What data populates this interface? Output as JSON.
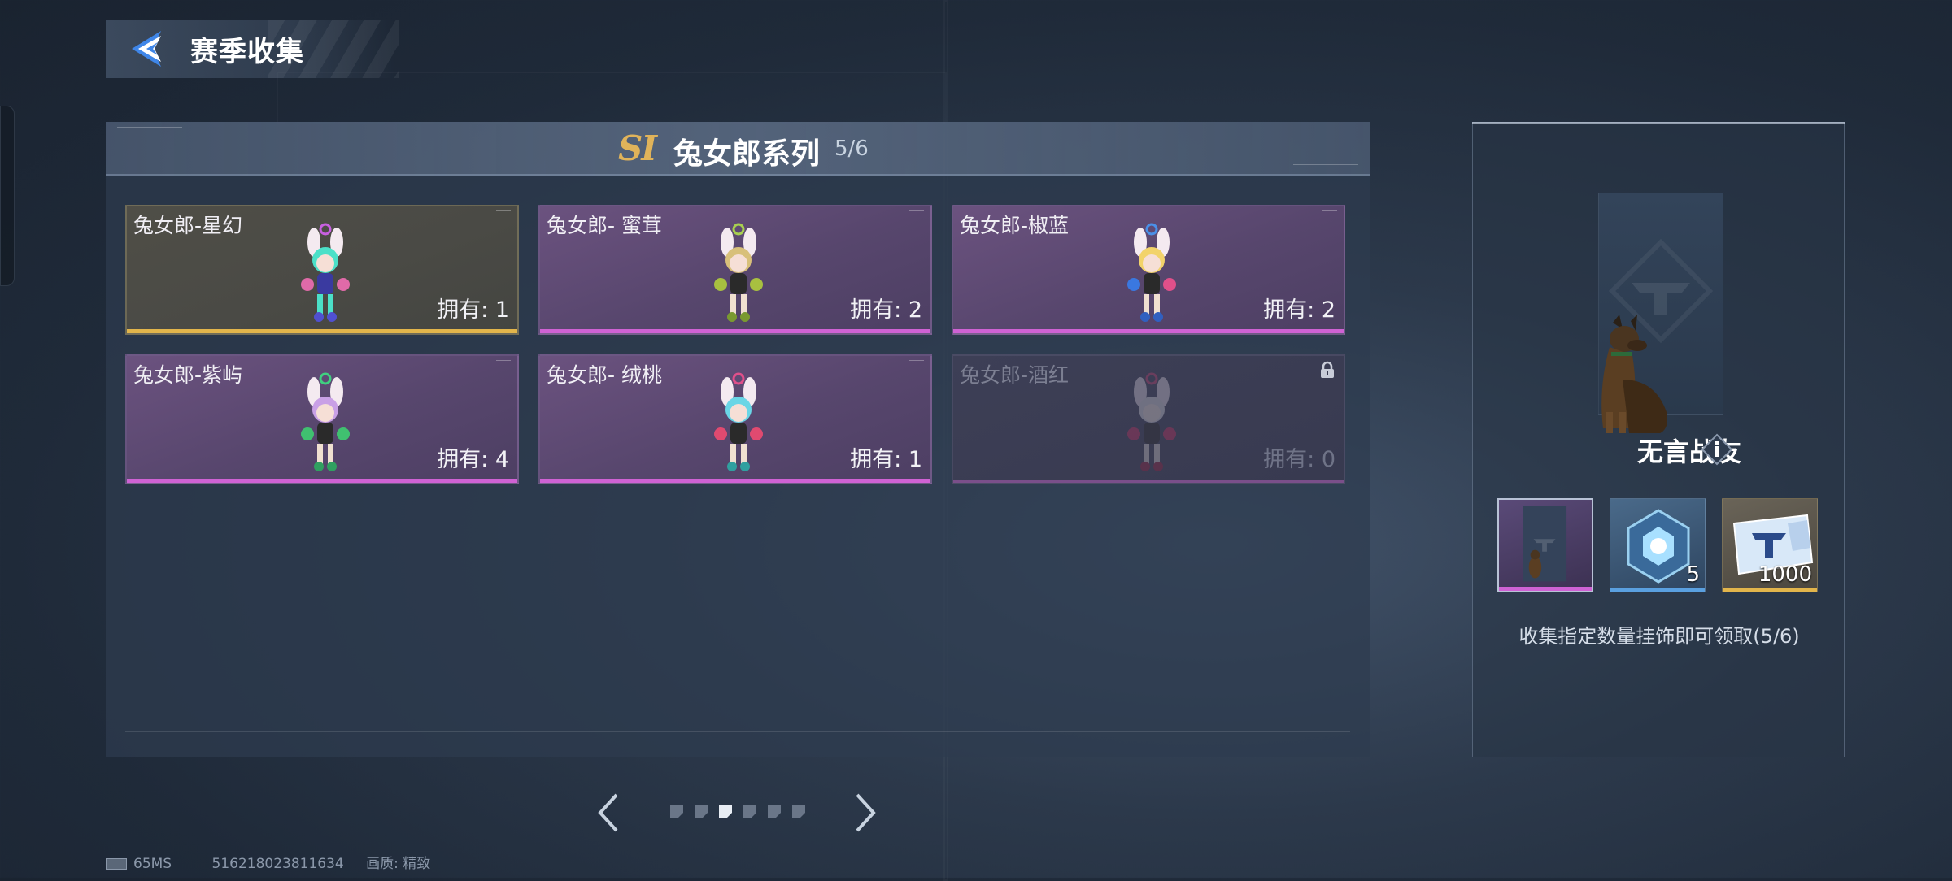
{
  "header": {
    "title": "赛季收集",
    "back_icon": "back-arrow-icon"
  },
  "series": {
    "badge": "SI",
    "title": "兔女郎系列",
    "count": "5/6"
  },
  "cards": [
    {
      "name": "兔女郎-星幻",
      "owned": "拥有: 1",
      "rarity": "gold",
      "locked": false,
      "color": "#4be0c8"
    },
    {
      "name": "兔女郎- 蜜茸",
      "owned": "拥有: 2",
      "rarity": "purple",
      "locked": false,
      "color": "#d8c07a"
    },
    {
      "name": "兔女郎-椒蓝",
      "owned": "拥有: 2",
      "rarity": "purple",
      "locked": false,
      "color": "#f2d36a"
    },
    {
      "name": "兔女郎-紫屿",
      "owned": "拥有: 4",
      "rarity": "purple",
      "locked": false,
      "color": "#c9a0e6"
    },
    {
      "name": "兔女郎- 绒桃",
      "owned": "拥有: 1",
      "rarity": "purple",
      "locked": false,
      "color": "#6ad6e6"
    },
    {
      "name": "兔女郎-酒红",
      "owned": "拥有: 0",
      "rarity": "purple",
      "locked": true,
      "color": "#cfcfd6"
    }
  ],
  "pager": {
    "page_count": 6,
    "current_page": 3
  },
  "reward": {
    "name": "无言战友",
    "items": [
      {
        "icon": "dog-emblem-icon",
        "qty": "",
        "bar_color": "#cf62d4"
      },
      {
        "icon": "crystal-core-icon",
        "qty": "5",
        "bar_color": "#5aa0e0"
      },
      {
        "icon": "ticket-icon",
        "qty": "1000",
        "bar_color": "#e2b54b"
      }
    ],
    "description": "收集指定数量挂饰即可领取(5/6)"
  },
  "status": {
    "ping": "65MS",
    "uid": "516218023811634",
    "quality": "画质: 精致"
  }
}
